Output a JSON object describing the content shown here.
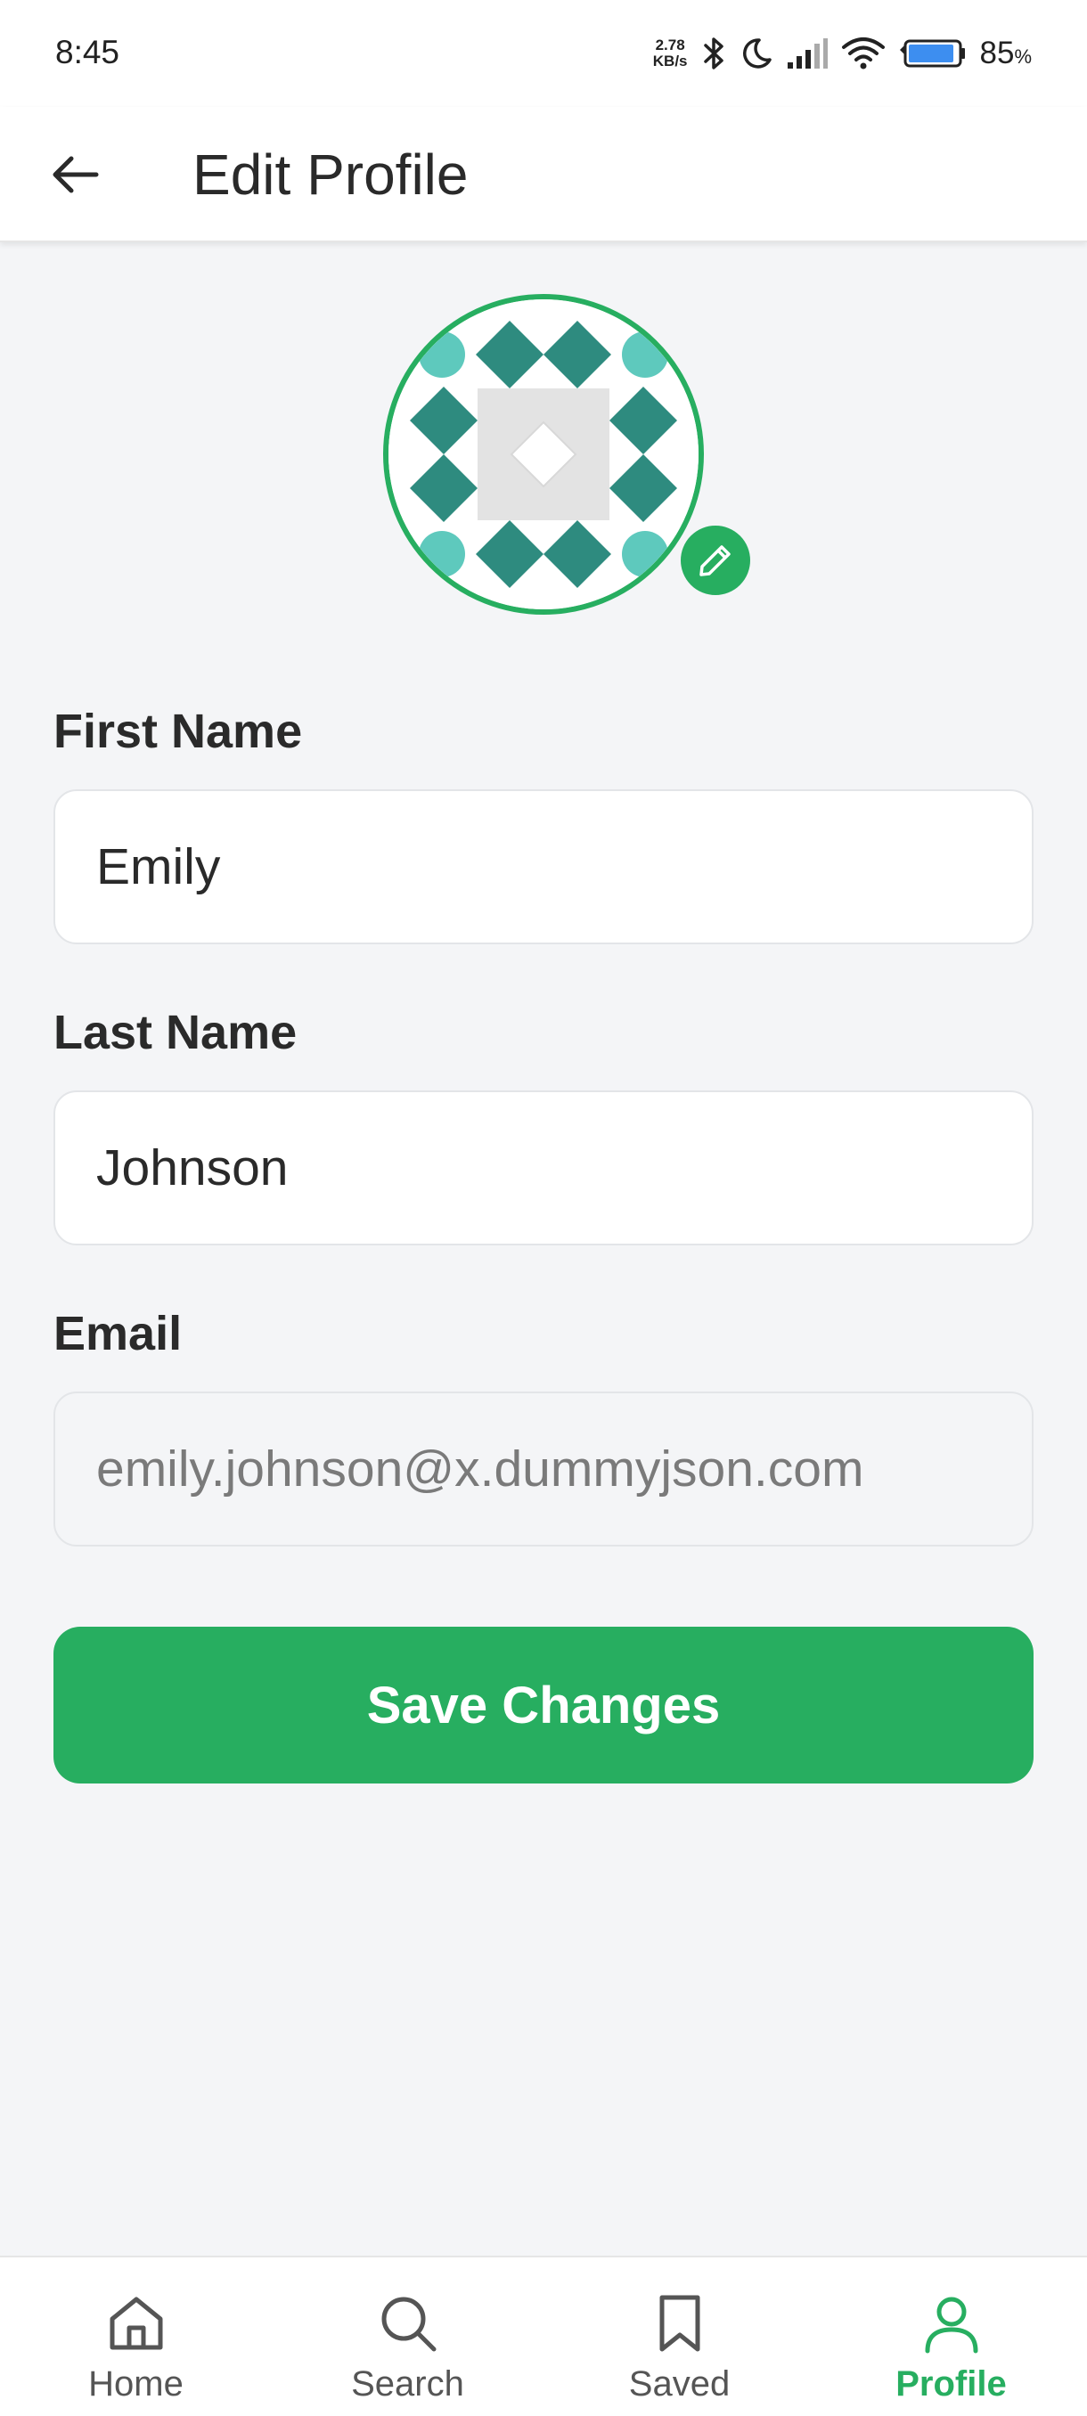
{
  "status_bar": {
    "time": "8:45",
    "net_speed_value": "2.78",
    "net_speed_unit": "KB/s",
    "battery_value": "85",
    "battery_unit": "%",
    "icons": [
      "bluetooth-icon",
      "moon-icon",
      "signal-icon",
      "wifi-icon",
      "battery-icon"
    ]
  },
  "app_bar": {
    "title": "Edit Profile",
    "back_icon": "arrow-left-icon"
  },
  "avatar": {
    "edit_icon": "pencil-icon",
    "ring_color": "#27ae60"
  },
  "form": {
    "first_name": {
      "label": "First Name",
      "value": "Emily"
    },
    "last_name": {
      "label": "Last Name",
      "value": "Johnson"
    },
    "email": {
      "label": "Email",
      "value": "emily.johnson@x.dummyjson.com",
      "disabled": true
    }
  },
  "save_button": {
    "label": "Save Changes"
  },
  "bottom_nav": {
    "items": [
      {
        "label": "Home",
        "icon": "home-icon",
        "active": false
      },
      {
        "label": "Search",
        "icon": "search-icon",
        "active": false
      },
      {
        "label": "Saved",
        "icon": "bookmark-icon",
        "active": false
      },
      {
        "label": "Profile",
        "icon": "user-icon",
        "active": true
      }
    ]
  },
  "colors": {
    "accent": "#27ae60",
    "background": "#f4f5f7",
    "avatar_pattern_dark": "#2e8b7f",
    "avatar_pattern_light": "#5ec9bd"
  }
}
